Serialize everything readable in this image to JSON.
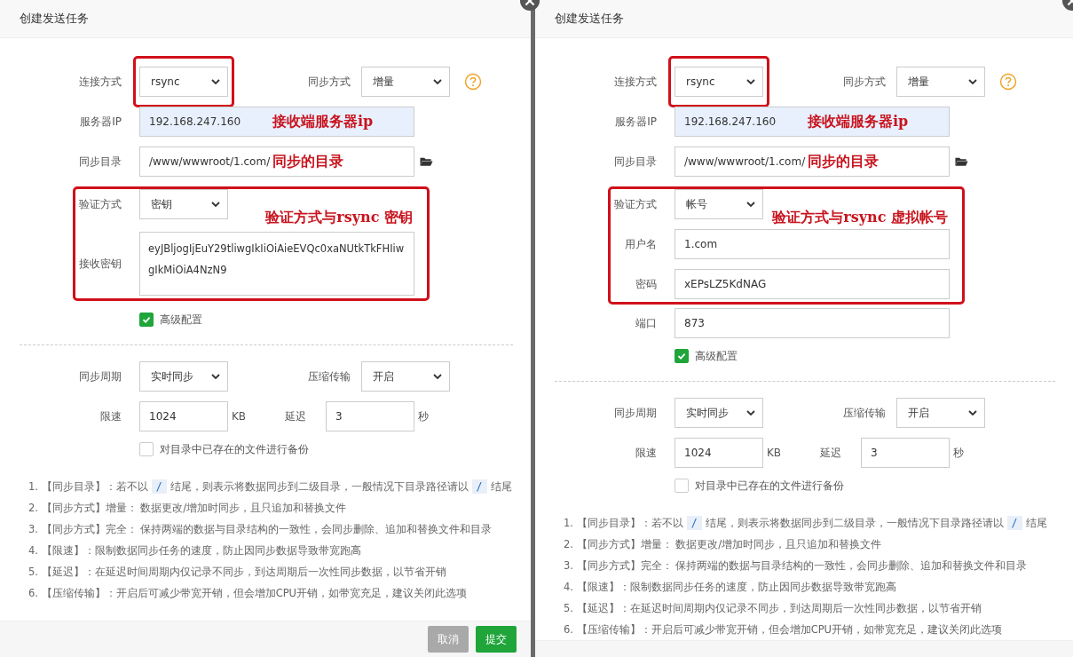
{
  "dialogs": [
    {
      "title": "创建发送任务",
      "rows": [
        {
          "kind": "select_pair",
          "label": "连接方式",
          "value": "rsync",
          "outlined": true,
          "label2": "同步方式",
          "value2": "增量",
          "help": true
        },
        {
          "kind": "input",
          "label": "服务器IP",
          "value": "192.168.247.160",
          "highlighted": true,
          "annotation": "接收端服务器ip"
        },
        {
          "kind": "input",
          "label": "同步目录",
          "value": "/www/wwwroot/1.com/",
          "annotation": "同步的目录",
          "folder": true
        },
        {
          "kind": "group",
          "annotation": "验证方式与rsync 密钥",
          "rows": [
            {
              "kind": "select",
              "label": "验证方式",
              "value": "密钥"
            },
            {
              "kind": "textarea",
              "label": "接收密钥",
              "value": "eyJBljogIjEuY29tliwgIkIiOiAieEVQc0xaNUtkTkFHIiwgIkMiOiA4NzN9"
            }
          ]
        },
        {
          "kind": "checkbox",
          "label": "高级配置",
          "checked": true
        },
        {
          "kind": "divider"
        },
        {
          "kind": "select_pair",
          "label": "同步周期",
          "value": "实时同步",
          "label2": "压缩传输",
          "value2": "开启"
        },
        {
          "kind": "input_pair",
          "label": "限速",
          "value": "1024",
          "unit": "KB",
          "label2": "延迟",
          "value2": "3",
          "unit2": "秒"
        },
        {
          "kind": "checkbox",
          "label": "对目录中已存在的文件进行备份",
          "checked": false
        }
      ],
      "notes": [
        [
          {
            "kind": "text",
            "text": "1. 【同步目录】：若不以"
          },
          {
            "kind": "code",
            "text": "/"
          },
          {
            "kind": "text",
            "text": "结尾，则表示将数据同步到二级目录，一般情况下目录路径请以"
          },
          {
            "kind": "code",
            "text": "/"
          },
          {
            "kind": "text",
            "text": "结尾"
          }
        ],
        [
          {
            "kind": "text",
            "text": "2. 【同步方式】增量：  数据更改/增加时同步，且只追加和替换文件"
          }
        ],
        [
          {
            "kind": "text",
            "text": "3. 【同步方式】完全：  保持两端的数据与目录结构的一致性，会同步删除、追加和替换文件和目录"
          }
        ],
        [
          {
            "kind": "text",
            "text": "4. 【限速】：限制数据同步任务的速度，防止因同步数据导致带宽跑高"
          }
        ],
        [
          {
            "kind": "text",
            "text": "5. 【延迟】：在延迟时间周期内仅记录不同步，到达周期后一次性同步数据，以节省开销"
          }
        ],
        [
          {
            "kind": "text",
            "text": "6. 【压缩传输】：开启后可减少带宽开销，但会增加CPU开销，如带宽充足，建议关闭此选项"
          }
        ]
      ],
      "buttons": [
        {
          "label": "取消",
          "kind": "cancel"
        },
        {
          "label": "提交",
          "kind": "submit"
        }
      ]
    },
    {
      "title": "创建发送任务",
      "rows": [
        {
          "kind": "select_pair",
          "label": "连接方式",
          "value": "rsync",
          "outlined": true,
          "label2": "同步方式",
          "value2": "增量",
          "help": true
        },
        {
          "kind": "input",
          "label": "服务器IP",
          "value": "192.168.247.160",
          "highlighted": true,
          "annotation": "接收端服务器ip"
        },
        {
          "kind": "input",
          "label": "同步目录",
          "value": "/www/wwwroot/1.com/",
          "annotation": "同步的目录",
          "folder": true
        },
        {
          "kind": "group",
          "annotation": "验证方式与rsync 虚拟帐号",
          "rows": [
            {
              "kind": "select",
              "label": "验证方式",
              "value": "帐号"
            },
            {
              "kind": "input",
              "label": "用户名",
              "value": "1.com"
            },
            {
              "kind": "input",
              "label": "密码",
              "value": "xEPsLZ5KdNAG"
            }
          ]
        },
        {
          "kind": "input",
          "label": "端口",
          "value": "873"
        },
        {
          "kind": "checkbox",
          "label": "高级配置",
          "checked": true
        },
        {
          "kind": "divider"
        },
        {
          "kind": "select_pair",
          "label": "同步周期",
          "value": "实时同步",
          "label2": "压缩传输",
          "value2": "开启"
        },
        {
          "kind": "input_pair",
          "label": "限速",
          "value": "1024",
          "unit": "KB",
          "label2": "延迟",
          "value2": "3",
          "unit2": "秒"
        },
        {
          "kind": "checkbox",
          "label": "对目录中已存在的文件进行备份",
          "checked": false
        }
      ],
      "notes": [
        [
          {
            "kind": "text",
            "text": "1. 【同步目录】：若不以"
          },
          {
            "kind": "code",
            "text": "/"
          },
          {
            "kind": "text",
            "text": "结尾，则表示将数据同步到二级目录，一般情况下目录路径请以"
          },
          {
            "kind": "code",
            "text": "/"
          },
          {
            "kind": "text",
            "text": "结尾"
          }
        ],
        [
          {
            "kind": "text",
            "text": "2. 【同步方式】增量：  数据更改/增加时同步，且只追加和替换文件"
          }
        ],
        [
          {
            "kind": "text",
            "text": "3. 【同步方式】完全：  保持两端的数据与目录结构的一致性，会同步删除、追加和替换文件和目录"
          }
        ],
        [
          {
            "kind": "text",
            "text": "4. 【限速】：限制数据同步任务的速度，防止因同步数据导致带宽跑高"
          }
        ],
        [
          {
            "kind": "text",
            "text": "5. 【延迟】：在延迟时间周期内仅记录不同步，到达周期后一次性同步数据，以节省开销"
          }
        ],
        [
          {
            "kind": "text",
            "text": "6. 【压缩传输】：开启后可减少带宽开销，但会增加CPU开销，如带宽充足，建议关闭此选项"
          }
        ]
      ]
    }
  ]
}
